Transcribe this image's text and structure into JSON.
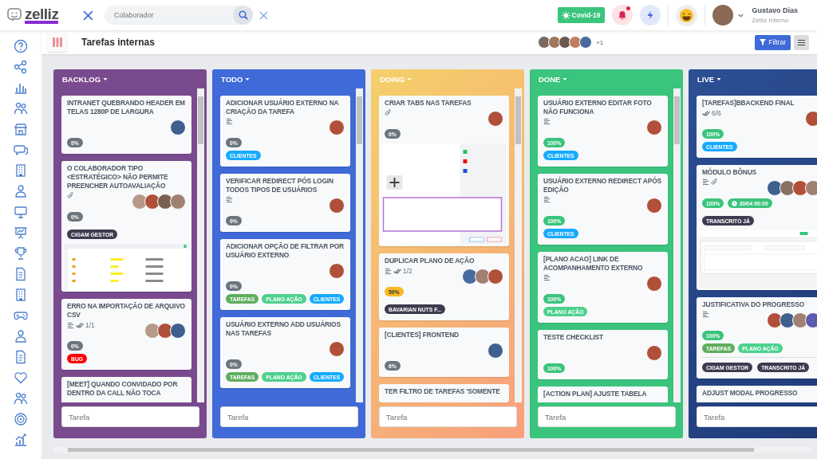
{
  "header": {
    "logo": "zelliz",
    "search": {
      "placeholder": "Colaborador"
    },
    "covid_button": "Covid-19",
    "notifications": {
      "unread": true
    },
    "user": {
      "name": "Gustavo Dias",
      "company": "Zelliz Interno",
      "avatar": {
        "color": "#8a6a55"
      }
    }
  },
  "sidebar": [
    {
      "kind": "help"
    },
    {
      "kind": "nodes"
    },
    {
      "kind": "chart"
    },
    {
      "kind": "people"
    },
    {
      "kind": "store"
    },
    {
      "kind": "chat"
    },
    {
      "kind": "building"
    },
    {
      "kind": "person"
    },
    {
      "kind": "monitor"
    },
    {
      "kind": "presentation"
    },
    {
      "kind": "trophy"
    },
    {
      "kind": "document"
    },
    {
      "kind": "building"
    },
    {
      "kind": "gamepad"
    },
    {
      "kind": "person"
    },
    {
      "kind": "document"
    },
    {
      "kind": "heart"
    },
    {
      "kind": "people"
    },
    {
      "kind": "target"
    },
    {
      "kind": "growth"
    }
  ],
  "board": {
    "title": "Tarefas internas",
    "members": [
      {
        "color": "#7a6a60"
      },
      {
        "color": "#a0785a"
      },
      {
        "color": "#6b5a50"
      },
      {
        "color": "#c08060"
      },
      {
        "color": "#4a6aa0"
      }
    ],
    "more_members": "+1",
    "filter_button": "Filtrar"
  },
  "columns": [
    {
      "name": "BACKLOG",
      "color": "#7a4a8e",
      "input_placeholder": "Tarefa",
      "cards": [
        {
          "title": "INTRANET QUEBRANDO HEADER EM TELAS 1280P DE LARGURA",
          "description": false,
          "attachment": false,
          "avatars": [
            {
              "color": "#3f5f8f"
            }
          ],
          "progress": {
            "text": "0%",
            "color": "#6c757d"
          }
        },
        {
          "title": "O COLABORADOR TIPO <ESTRATÉGICO> NÃO PERMITE PREENCHER AUTOAVALIAÇÃO",
          "description": false,
          "attachment": true,
          "avatars": [
            {
              "color": "#b59a88"
            },
            {
              "color": "#b0503a"
            },
            {
              "color": "#7a6050"
            },
            {
              "color": "#a08070"
            }
          ],
          "progress": {
            "text": "0%",
            "color": "#6c757d"
          },
          "labels": [
            "CIGAM GESTOR"
          ],
          "preview": {
            "kind": "picture"
          }
        },
        {
          "title": "ERRO NA IMPORTAÇÃO DE ARQUIVO CSV",
          "description": true,
          "checklist": "1/1",
          "attachment": false,
          "avatars": [
            {
              "color": "#b59a88"
            },
            {
              "color": "#b0503a"
            },
            {
              "color": "#3f5f8f"
            }
          ],
          "progress": {
            "text": "0%",
            "color": "#6c757d"
          },
          "tags": [
            {
              "text": "BUG",
              "color": "#ff0000"
            }
          ]
        },
        {
          "title": "[MEET] QUANDO CONVIDADO POR DENTRO DA CALL NÃO TOCA",
          "description": false,
          "attachment": false
        }
      ]
    },
    {
      "name": "TODO",
      "color": "#3f6ad8",
      "input_placeholder": "Tarefa",
      "cards": [
        {
          "title": "ADICIONAR USUÁRIO EXTERNO NA CRIAÇÃO DA TAREFA",
          "description": true,
          "attachment": false,
          "avatars": [
            {
              "color": "#b0503a"
            }
          ],
          "progress": {
            "text": "0%",
            "color": "#6c757d"
          },
          "tags": [
            {
              "text": "CLIENTES",
              "color": "#16aaff"
            }
          ]
        },
        {
          "title": "VERIFICAR REDIRECT PÓS LOGIN TODOS TIPOS DE USUÁRIOS",
          "description": true,
          "attachment": false,
          "avatars": [
            {
              "color": "#b0503a"
            }
          ],
          "progress": {
            "text": "0%",
            "color": "#6c757d"
          }
        },
        {
          "title": "ADICIONAR OPÇÃO DE FILTRAR POR USUÁRIO EXTERNO",
          "description": false,
          "attachment": false,
          "avatars": [
            {
              "color": "#b0503a"
            }
          ],
          "progress": {
            "text": "0%",
            "color": "#6c757d"
          },
          "tags": [
            {
              "text": "TAREFAS",
              "color": "#5fae5f"
            },
            {
              "text": "PLANO AÇÃO",
              "color": "#4cd18c"
            },
            {
              "text": "CLIENTES",
              "color": "#16aaff"
            }
          ]
        },
        {
          "title": "USUÁRIO EXTERNO ADD USUÁRIOS NAS TAREFAS",
          "description": false,
          "attachment": false,
          "avatars": [
            {
              "color": "#b0503a"
            }
          ],
          "progress": {
            "text": "0%",
            "color": "#6c757d"
          },
          "tags": [
            {
              "text": "TAREFAS",
              "color": "#5fae5f"
            },
            {
              "text": "PLANO AÇÃO",
              "color": "#4cd18c"
            },
            {
              "text": "CLIENTES",
              "color": "#16aaff"
            }
          ]
        }
      ]
    },
    {
      "name": "DOING",
      "color": "#f4d06a",
      "fade": {
        "color": "#f8a07c"
      },
      "input_placeholder": "Tarefa",
      "cards": [
        {
          "title": "CRIAR TABS NAS TAREFAS",
          "description": false,
          "attachment": true,
          "avatars": [
            {
              "color": "#b0503a"
            }
          ],
          "progress": {
            "text": "0%",
            "color": "#6c757d"
          },
          "preview": {
            "kind": "picture"
          }
        },
        {
          "title": "DUPLICAR PLANO DE AÇÃO",
          "description": true,
          "checklist": "1/2",
          "attachment": false,
          "avatars": [
            {
              "color": "#4a6aa0"
            },
            {
              "color": "#a08070"
            },
            {
              "color": "#b0503a"
            }
          ],
          "progress": {
            "text": "50%",
            "color": "#f7b924"
          },
          "labels": [
            "BAVARIAN NUTS F..."
          ]
        },
        {
          "title": "[CLIENTES] FRONTEND",
          "description": false,
          "attachment": false,
          "avatars": [
            {
              "color": "#3f5f8f"
            }
          ],
          "progress": {
            "text": "6%",
            "color": "#6c757d"
          }
        },
        {
          "title": "TER FILTRO DE TAREFAS 'SOMENTE",
          "description": false,
          "attachment": false
        }
      ]
    },
    {
      "name": "DONE",
      "color": "#3ac47d",
      "input_placeholder": "Tarefa",
      "cards": [
        {
          "title": "USUÁRIO EXTERNO EDITAR FOTO NÃO FUNCIONA",
          "description": true,
          "attachment": false,
          "avatars": [
            {
              "color": "#b0503a"
            }
          ],
          "progress": {
            "text": "100%",
            "color": "#3ac47d"
          },
          "tags": [
            {
              "text": "CLIENTES",
              "color": "#16aaff"
            }
          ]
        },
        {
          "title": "USUÁRIO EXTERNO REDIRECT APÓS EDIÇÃO",
          "description": true,
          "attachment": false,
          "avatars": [
            {
              "color": "#b0503a"
            }
          ],
          "progress": {
            "text": "100%",
            "color": "#3ac47d"
          },
          "tags": [
            {
              "text": "CLIENTES",
              "color": "#16aaff"
            }
          ]
        },
        {
          "title": "[PLANO ACAO] LINK DE ACOMPANHAMENTO EXTERNO",
          "description": true,
          "attachment": false,
          "avatars": [
            {
              "color": "#b0503a"
            }
          ],
          "progress": {
            "text": "100%",
            "color": "#3ac47d"
          },
          "tags": [
            {
              "text": "PLANO AÇÃO",
              "color": "#4cd18c"
            }
          ]
        },
        {
          "title": "TESTE CHECKLIST",
          "description": false,
          "attachment": false,
          "avatars": [
            {
              "color": "#b0503a"
            }
          ],
          "progress": {
            "text": "100%",
            "color": "#3ac47d"
          }
        },
        {
          "title": "[ACTION PLAN] AJUSTE TABELA",
          "description": false,
          "attachment": false
        }
      ]
    },
    {
      "name": "LIVE",
      "color": "#2c4f94",
      "fade": {
        "color": "#1f3b78"
      },
      "input_placeholder": "Tarefa",
      "cards": [
        {
          "title": "[TAREFAS]BBACKEND FINAL",
          "description": false,
          "checklist": "6/6",
          "attachment": false,
          "avatars": [
            {
              "color": "#b0503a"
            }
          ],
          "progress": {
            "text": "100%",
            "color": "#3ac47d"
          },
          "tags": [
            {
              "text": "CLIENTES",
              "color": "#16aaff"
            }
          ]
        },
        {
          "title": "MÓDULO BÔNUS",
          "description": true,
          "attachment": true,
          "avatars": [
            {
              "color": "#3f5f8f"
            },
            {
              "color": "#8a7060"
            },
            {
              "color": "#b0503a"
            },
            {
              "color": "#a08070"
            }
          ],
          "progress": {
            "text": "100%",
            "color": "#3ac47d"
          },
          "due": "30/04 00:00",
          "labels": [
            "TRANSCRITO JÁ"
          ],
          "preview": {
            "kind": "picture"
          }
        },
        {
          "title": "JUSTIFICATIVA DO PROGRESSO",
          "description": true,
          "attachment": false,
          "avatars": [
            {
              "color": "#b0503a"
            },
            {
              "color": "#3f5f8f"
            },
            {
              "color": "#a08070"
            },
            {
              "color": "#5a5ab0"
            }
          ],
          "progress": {
            "text": "100%",
            "color": "#3ac47d"
          },
          "tags": [
            {
              "text": "TAREFAS",
              "color": "#5fae5f"
            },
            {
              "text": "PLANO AÇÃO",
              "color": "#4cd18c"
            }
          ],
          "labels": [
            "CIGAM GESTOR",
            "TRANSCRITO JÁ"
          ]
        },
        {
          "title": "ADJUST MODAL PROGRESSO",
          "description": false,
          "attachment": false
        }
      ]
    }
  ]
}
